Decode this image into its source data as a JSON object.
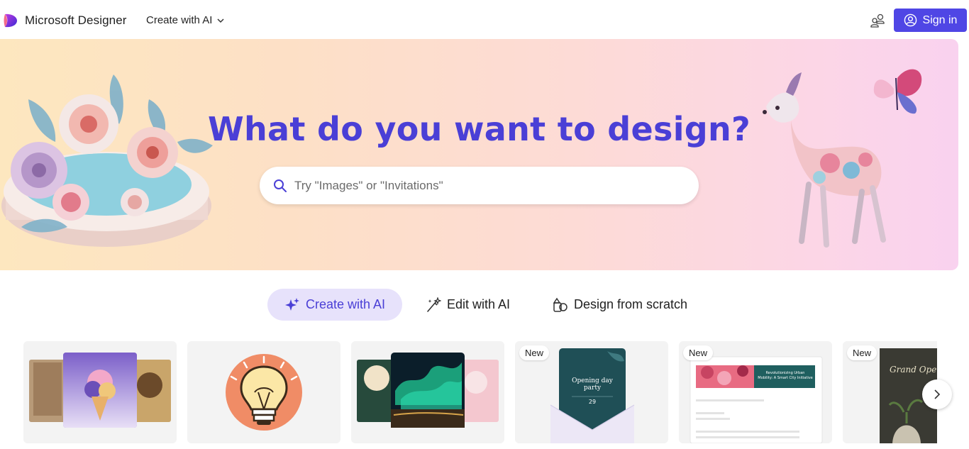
{
  "header": {
    "brand": "Microsoft Designer",
    "nav_create": "Create with AI",
    "share_icon": "share-people-icon",
    "signin_label": "Sign in"
  },
  "hero": {
    "title": "What do you want to design?",
    "search_placeholder": "Try \"Images\" or \"Invitations\""
  },
  "modes": [
    {
      "label": "Create with AI",
      "icon": "sparkle-icon",
      "selected": true
    },
    {
      "label": "Edit with AI",
      "icon": "magic-wand-icon",
      "selected": false
    },
    {
      "label": "Design from scratch",
      "icon": "shapes-icon",
      "selected": false
    }
  ],
  "cards": [
    {
      "kind": "images",
      "badge": ""
    },
    {
      "kind": "stickers",
      "badge": ""
    },
    {
      "kind": "wallpapers",
      "badge": ""
    },
    {
      "kind": "invitation",
      "badge": "New",
      "invite_title": "Opening day party",
      "invite_date": "29"
    },
    {
      "kind": "banner",
      "badge": "New",
      "banner_text": "Revolutionizing Urban Mobility: A Smart City Initiative"
    },
    {
      "kind": "poster",
      "badge": "New",
      "poster_text": "Grand Openin"
    }
  ],
  "colors": {
    "accent": "#4f46e5",
    "title": "#4a3fd6",
    "pill": "#e7e2fb"
  }
}
